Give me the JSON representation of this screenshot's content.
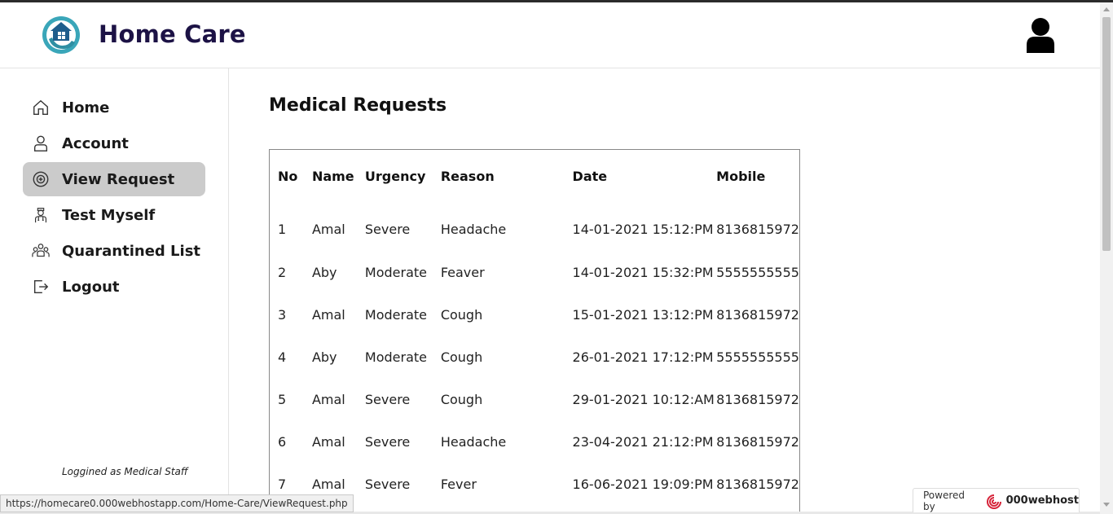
{
  "header": {
    "brand": "Home Care",
    "logo_icon": "house-in-hand-icon",
    "avatar_icon": "user-avatar-icon"
  },
  "sidebar": {
    "items": [
      {
        "label": "Home",
        "icon": "home-icon",
        "active": false
      },
      {
        "label": "Account",
        "icon": "user-icon",
        "active": false
      },
      {
        "label": "View Request",
        "icon": "medical-request-icon",
        "active": true
      },
      {
        "label": "Test Myself",
        "icon": "doctor-icon",
        "active": false
      },
      {
        "label": "Quarantined List",
        "icon": "group-icon",
        "active": false
      },
      {
        "label": "Logout",
        "icon": "logout-icon",
        "active": false
      }
    ],
    "logged_as": "Loggined as Medical Staff"
  },
  "main": {
    "title": "Medical Requests",
    "table": {
      "columns": [
        "No",
        "Name",
        "Urgency",
        "Reason",
        "Date",
        "Mobile"
      ],
      "rows": [
        [
          "1",
          "Amal",
          "Severe",
          "Headache",
          "14-01-2021 15:12:PM",
          "8136815972"
        ],
        [
          "2",
          "Aby",
          "Moderate",
          "Feaver",
          "14-01-2021 15:32:PM",
          "5555555555"
        ],
        [
          "3",
          "Amal",
          "Moderate",
          "Cough",
          "15-01-2021 13:12:PM",
          "8136815972"
        ],
        [
          "4",
          "Aby",
          "Moderate",
          "Cough",
          "26-01-2021 17:12:PM",
          "5555555555"
        ],
        [
          "5",
          "Amal",
          "Severe",
          "Cough",
          "29-01-2021 10:12:AM",
          "8136815972"
        ],
        [
          "6",
          "Amal",
          "Severe",
          "Headache",
          "23-04-2021 21:12:PM",
          "8136815972"
        ],
        [
          "7",
          "Amal",
          "Severe",
          "Fever",
          "16-06-2021 19:09:PM",
          "8136815972"
        ]
      ]
    }
  },
  "status_bar": {
    "url": "https://homecare0.000webhostapp.com/Home-Care/ViewRequest.php"
  },
  "badge": {
    "powered_by": "Powered by",
    "brand": "000webhost"
  },
  "colors": {
    "brand_text": "#1c1245",
    "logo_teal": "#3aa6b9",
    "active_nav": "#cbcbcb"
  }
}
